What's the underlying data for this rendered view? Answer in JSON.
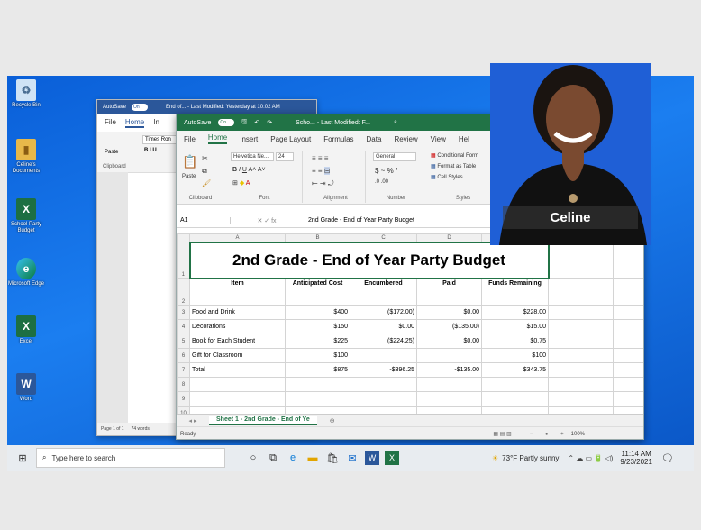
{
  "desktop_icons": [
    {
      "label": "Recycle Bin",
      "icon": "recycle-bin-icon"
    },
    {
      "label": "Celine's Documents",
      "icon": "folder-icon"
    },
    {
      "label": "School Party Budget",
      "icon": "excel-file-icon"
    },
    {
      "label": "Microsoft Edge",
      "icon": "edge-icon"
    },
    {
      "label": "Excel",
      "icon": "excel-icon"
    },
    {
      "label": "Word",
      "icon": "word-icon"
    }
  ],
  "word_window": {
    "autosave": "AutoSave",
    "toggle": "On",
    "title": "End of... - Last Modified: Yesterday at 10:02 AM",
    "menu": [
      "File",
      "Home",
      "In"
    ],
    "font": "Times Ron",
    "paste": "Paste",
    "clipboard": "Clipboard",
    "status_page": "Page 1 of 1",
    "status_words": "74 words"
  },
  "excel_window": {
    "autosave": "AutoSave",
    "toggle": "On",
    "title": "Scho... - Last Modified: F...",
    "menu": [
      "File",
      "Home",
      "Insert",
      "Page Layout",
      "Formulas",
      "Data",
      "Review",
      "View",
      "Hel"
    ],
    "ribbon": {
      "paste": "Paste",
      "font_name": "Helvetica Ne...",
      "font_size": "24",
      "number_format": "General",
      "conditional": "Conditional Form",
      "format_table": "Format as Table",
      "cell_styles": "Cell Styles",
      "group_labels": [
        "Clipboard",
        "Font",
        "Alignment",
        "Number",
        "Styles"
      ]
    },
    "name_box": "A1",
    "formula": "2nd Grade - End of Year Party Budget",
    "column_headers": [
      "A",
      "B",
      "C",
      "D"
    ],
    "sheet_title": "2nd Grade - End of Year Party Budget",
    "table_headers": [
      "Item",
      "Anticipated Cost",
      "Encumbered",
      "Paid",
      "Funds Remaining"
    ],
    "rows": [
      [
        "Food  and Drink",
        "$400",
        "($172.00)",
        "$0.00",
        "$228.00"
      ],
      [
        "Decorations",
        "$150",
        "$0.00",
        "($135.00)",
        "$15.00"
      ],
      [
        "Book for Each Student",
        "$225",
        "($224.25)",
        "$0.00",
        "$0.75"
      ],
      [
        "Gift for Classroom",
        "$100",
        "",
        "",
        "$100"
      ],
      [
        "Total",
        "$875",
        "-$396.25",
        "-$135.00",
        "$343.75"
      ]
    ],
    "row_numbers": [
      "1",
      "2",
      "3",
      "4",
      "5",
      "6",
      "7",
      "8",
      "9",
      "10"
    ],
    "sheet_tab": "Sheet 1 - 2nd Grade - End of Ye",
    "status": "Ready",
    "zoom": "100%"
  },
  "presenter": {
    "name": "Celine"
  },
  "taskbar": {
    "search_placeholder": "Type here to search",
    "weather": "73°F  Partly sunny",
    "time": "11:14 AM",
    "date": "9/23/2021"
  },
  "colors": {
    "excel_green": "#217346",
    "word_blue": "#2b579a",
    "desktop_blue": "#1b7ef0"
  }
}
